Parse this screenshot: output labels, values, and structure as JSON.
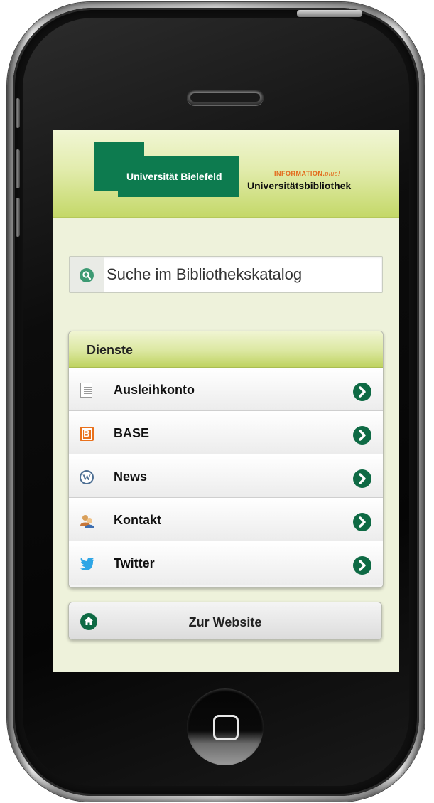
{
  "header": {
    "logo_university": "Universität Bielefeld",
    "logo_information": "INFORMATION.",
    "logo_plus": "plus!",
    "logo_library": "Universitätsbibliothek"
  },
  "search": {
    "placeholder": "Suche im Bibliothekskatalog"
  },
  "services": {
    "title": "Dienste",
    "items": [
      {
        "label": "Ausleihkonto",
        "icon": "document-icon"
      },
      {
        "label": "BASE",
        "icon": "base-icon"
      },
      {
        "label": "News",
        "icon": "wordpress-icon"
      },
      {
        "label": "Kontakt",
        "icon": "contacts-icon"
      },
      {
        "label": "Twitter",
        "icon": "twitter-icon"
      }
    ]
  },
  "website_button": {
    "label": "Zur Website",
    "icon": "home-icon"
  },
  "colors": {
    "brand_green": "#0d7b4f",
    "header_lime": "#c4d868",
    "accent_orange": "#e36a1b"
  }
}
